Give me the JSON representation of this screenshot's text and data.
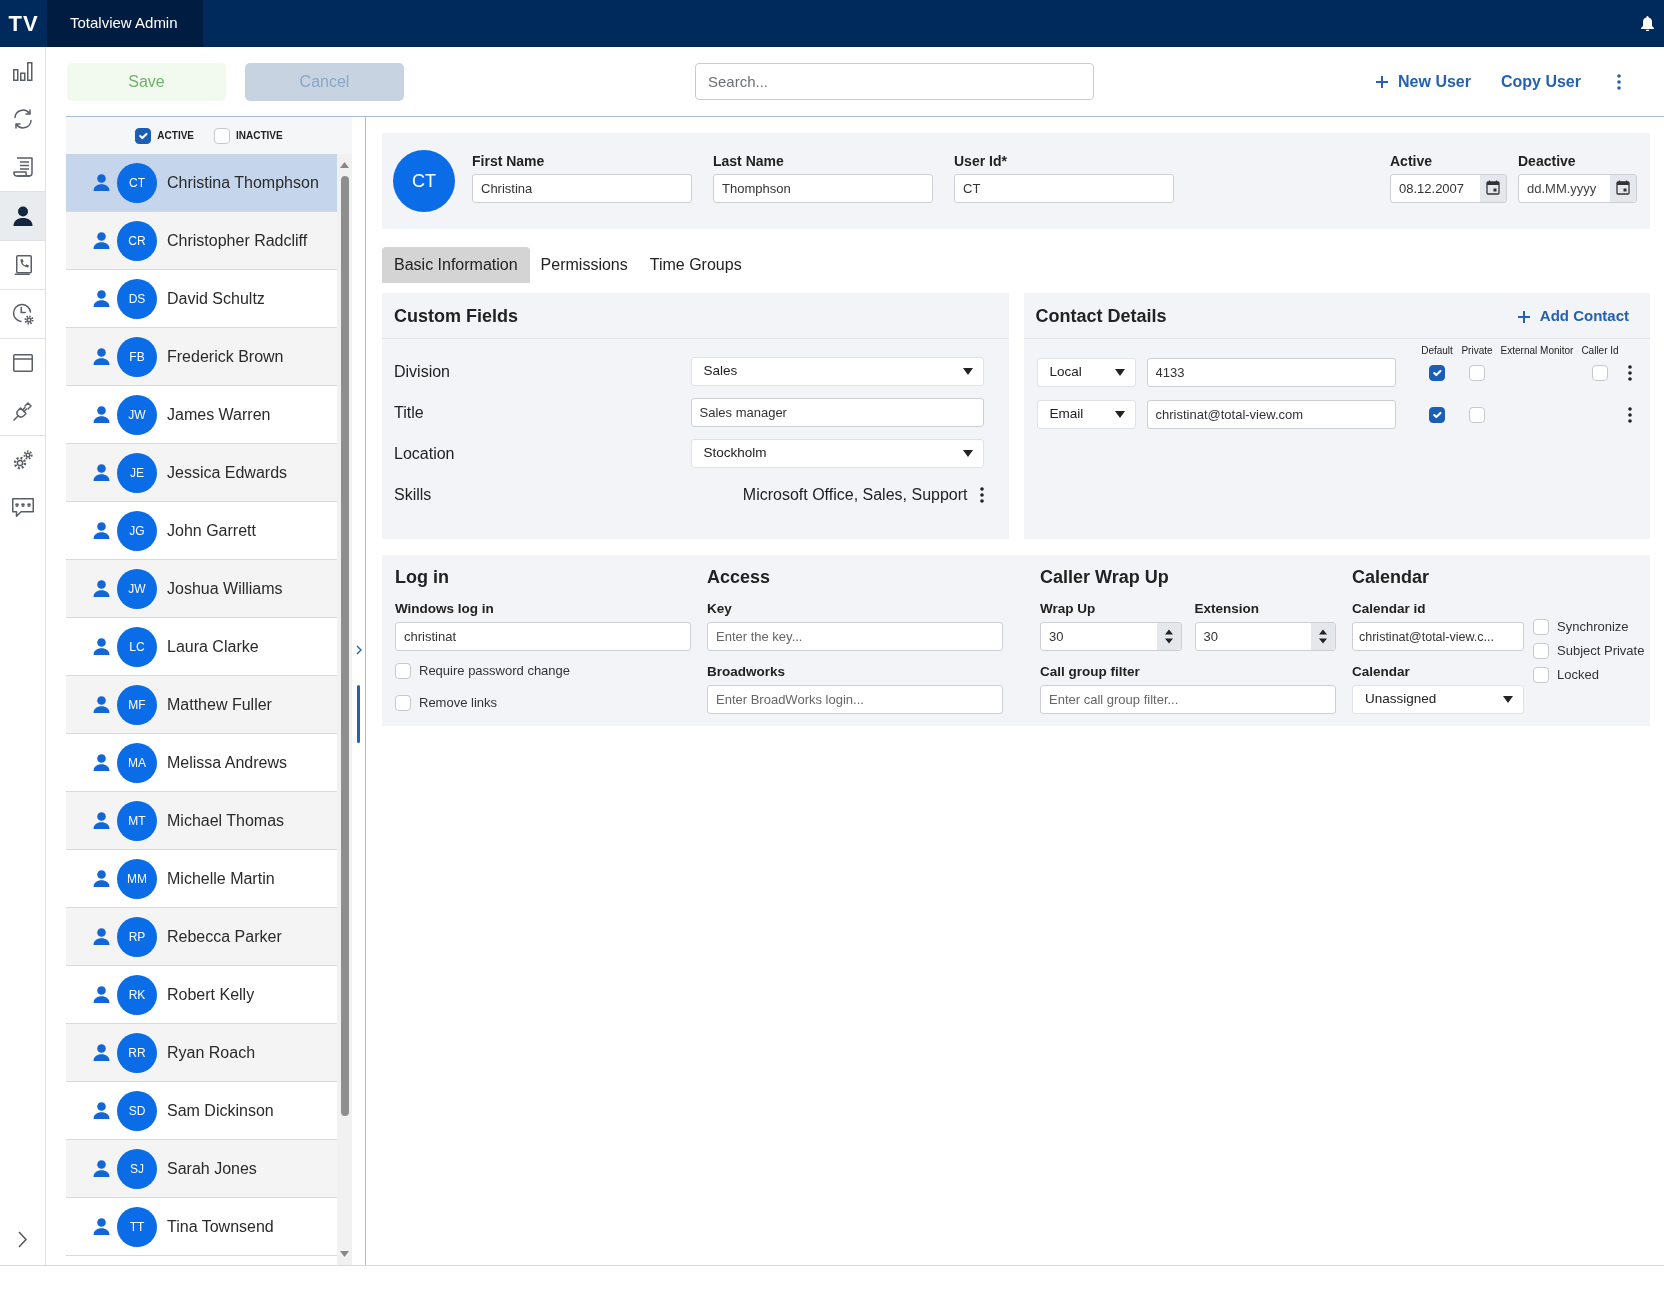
{
  "header": {
    "logo": "TV",
    "title": "Totalview Admin"
  },
  "nav_groups": [
    {
      "items": [
        {
          "kind": "chart",
          "selected": false
        },
        {
          "kind": "sync",
          "selected": false
        },
        {
          "kind": "document",
          "selected": false
        }
      ]
    },
    {
      "items": [
        {
          "kind": "user",
          "selected": true
        }
      ]
    },
    {
      "items": [
        {
          "kind": "phonebook",
          "selected": false
        }
      ]
    },
    {
      "items": [
        {
          "kind": "clock",
          "selected": false
        }
      ]
    },
    {
      "items": [
        {
          "kind": "window",
          "selected": false
        },
        {
          "kind": "plug",
          "selected": false
        }
      ]
    },
    {
      "items": [
        {
          "kind": "gears",
          "selected": false
        },
        {
          "kind": "chat",
          "selected": false
        }
      ]
    }
  ],
  "toolbar": {
    "buttons": [
      {
        "kind": "save",
        "label": "Save",
        "disabled": true
      },
      {
        "kind": "cancel",
        "label": "Cancel",
        "disabled": true
      }
    ],
    "search": {
      "placeholder": "Search..."
    },
    "actions": [
      {
        "kind": "add",
        "label": "New User"
      },
      {
        "kind": "plain",
        "label": "Copy User"
      }
    ]
  },
  "user_list": {
    "filters": [
      {
        "label": "ACTIVE",
        "checked": true
      },
      {
        "label": "INACTIVE",
        "checked": false
      }
    ],
    "users": [
      {
        "initials": "CT",
        "name": "Christina Thomphson",
        "selected": true
      },
      {
        "initials": "CR",
        "name": "Christopher Radcliff",
        "selected": false
      },
      {
        "initials": "DS",
        "name": "David Schultz",
        "selected": false
      },
      {
        "initials": "FB",
        "name": "Frederick Brown",
        "selected": false
      },
      {
        "initials": "JW",
        "name": "James Warren",
        "selected": false
      },
      {
        "initials": "JE",
        "name": "Jessica Edwards",
        "selected": false
      },
      {
        "initials": "JG",
        "name": "John Garrett",
        "selected": false
      },
      {
        "initials": "JW",
        "name": "Joshua Williams",
        "selected": false
      },
      {
        "initials": "LC",
        "name": "Laura Clarke",
        "selected": false
      },
      {
        "initials": "MF",
        "name": "Matthew Fuller",
        "selected": false
      },
      {
        "initials": "MA",
        "name": "Melissa Andrews",
        "selected": false
      },
      {
        "initials": "MT",
        "name": "Michael Thomas",
        "selected": false
      },
      {
        "initials": "MM",
        "name": "Michelle Martin",
        "selected": false
      },
      {
        "initials": "RP",
        "name": "Rebecca Parker",
        "selected": false
      },
      {
        "initials": "RK",
        "name": "Robert Kelly",
        "selected": false
      },
      {
        "initials": "RR",
        "name": "Ryan Roach",
        "selected": false
      },
      {
        "initials": "SD",
        "name": "Sam Dickinson",
        "selected": false
      },
      {
        "initials": "SJ",
        "name": "Sarah Jones",
        "selected": false
      },
      {
        "initials": "TT",
        "name": "Tina Townsend",
        "selected": false
      }
    ]
  },
  "user": {
    "initials": "CT",
    "fields": [
      {
        "label": "First Name",
        "value": "Christina"
      },
      {
        "label": "Last Name",
        "value": "Thomphson"
      },
      {
        "label": "User Id*",
        "value": "CT"
      }
    ],
    "dates": [
      {
        "label": "Active",
        "value": "08.12.2007"
      },
      {
        "label": "Deactive",
        "placeholder": "dd.MM.yyyy"
      }
    ]
  },
  "tabs": [
    {
      "label": "Basic Information",
      "selected": true
    },
    {
      "label": "Permissions",
      "selected": false
    },
    {
      "label": "Time Groups",
      "selected": false
    }
  ],
  "custom_fields": {
    "title": "Custom Fields",
    "rows": [
      {
        "kind": "select",
        "label": "Division",
        "value": "Sales"
      },
      {
        "kind": "input",
        "label": "Title",
        "value": "Sales manager"
      },
      {
        "kind": "select",
        "label": "Location",
        "value": "Stockholm"
      },
      {
        "kind": "text",
        "label": "Skills",
        "value": "Microsoft Office, Sales, Support"
      }
    ]
  },
  "contact_details": {
    "title": "Contact Details",
    "add_label": "Add Contact",
    "columns": [
      "Default",
      "Private",
      "External Monitor",
      "Caller Id"
    ],
    "rows": [
      {
        "type": "Local",
        "value": "4133",
        "default": true,
        "private": false,
        "caller_id": false
      },
      {
        "type": "Email",
        "value": "christinat@total-view.com",
        "default": true,
        "private": false
      }
    ]
  },
  "login": {
    "title": "Log in",
    "field": {
      "label": "Windows log in",
      "value": "christinat"
    },
    "checks": [
      {
        "label": "Require password change",
        "checked": false
      },
      {
        "label": "Remove links",
        "checked": false
      }
    ]
  },
  "access": {
    "title": "Access",
    "fields": [
      {
        "label": "Key",
        "placeholder": "Enter the key..."
      },
      {
        "label": "Broadworks",
        "placeholder": "Enter BroadWorks login..."
      }
    ]
  },
  "caller_wrap_up": {
    "title": "Caller Wrap Up",
    "spinners": [
      {
        "label": "Wrap Up",
        "value": "30"
      },
      {
        "label": "Extension",
        "value": "30"
      }
    ],
    "filter": {
      "label": "Call group filter",
      "placeholder": "Enter call group filter..."
    }
  },
  "calendar": {
    "title": "Calendar",
    "calendar_id": {
      "label": "Calendar id",
      "value": "christinat@total-view.c..."
    },
    "calendar": {
      "label": "Calendar",
      "value": "Unassigned"
    },
    "checks": [
      {
        "label": "Synchronize",
        "checked": false
      },
      {
        "label": "Subject Private",
        "checked": false
      },
      {
        "label": "Locked",
        "checked": false
      }
    ]
  }
}
